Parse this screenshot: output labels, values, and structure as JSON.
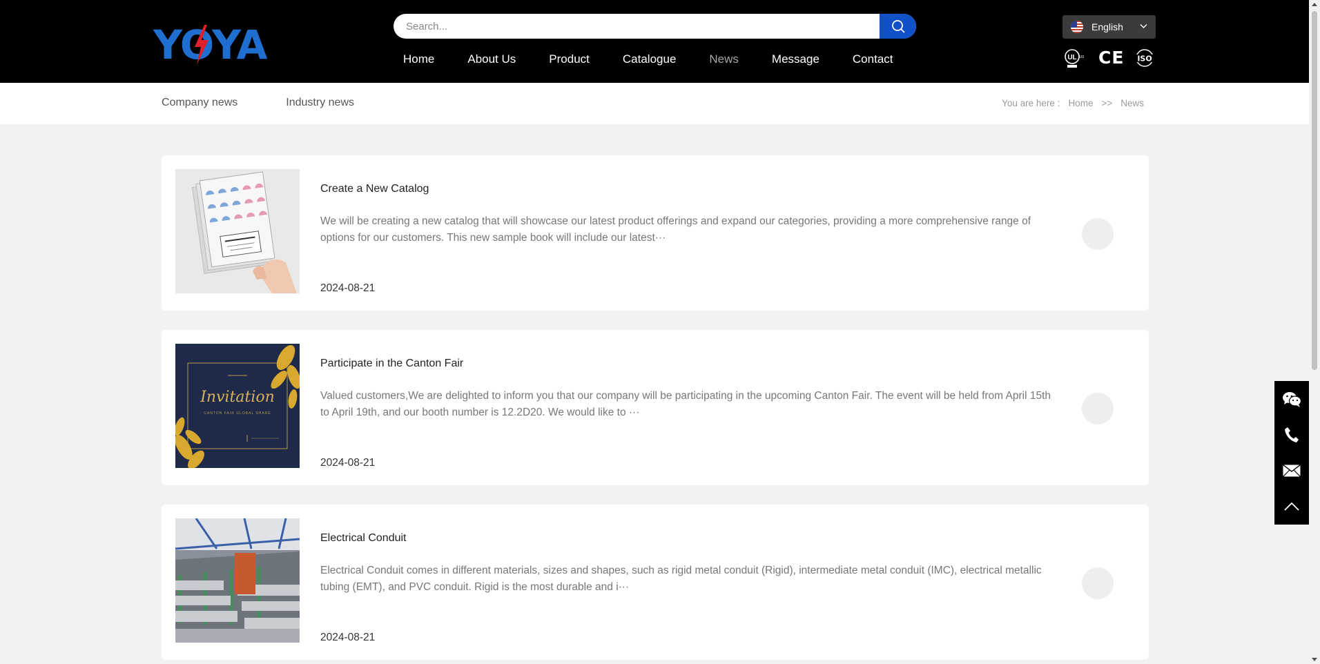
{
  "header": {
    "logo_text": "YOYA",
    "search": {
      "placeholder": "Search..."
    },
    "nav": [
      {
        "label": "Home",
        "active": false
      },
      {
        "label": "About Us",
        "active": false
      },
      {
        "label": "Product",
        "active": false
      },
      {
        "label": "Catalogue",
        "active": false
      },
      {
        "label": "News",
        "active": true
      },
      {
        "label": "Message",
        "active": false
      },
      {
        "label": "Contact",
        "active": false
      }
    ],
    "language": {
      "label": "English",
      "flag": "us-flag-icon"
    },
    "certifications": [
      "UL",
      "CE",
      "ISO"
    ]
  },
  "subnav": {
    "categories": [
      "Company news",
      "Industry news"
    ],
    "breadcrumb": {
      "prefix": "You are here :",
      "home": "Home",
      "separator": ">>",
      "current": "News"
    }
  },
  "news": [
    {
      "title": "Create a New Catalog",
      "desc": "We will be creating a new catalog that will showcase our latest product offerings and expand our categories, providing a more comprehensive range of options for our customers. This new sample book will include our latest···",
      "date": "2024-08-21"
    },
    {
      "title": "Participate in the Canton Fair",
      "desc": "Valued customers,We are delighted to inform you that our company will be participating in the upcoming Canton Fair. The event will be held from April 15th to April 19th, and our booth number is 12.2D20. We would like to ···",
      "date": "2024-08-21",
      "image_text": "Invitation",
      "image_subtext": "CANTON FAIR GLOBAL SHARE"
    },
    {
      "title": "Electrical Conduit",
      "desc": "Electrical Conduit comes in different materials, sizes and shapes, such as rigid metal conduit (Rigid), intermediate metal conduit (IMC), electrical metallic tubing (EMT), and PVC conduit. Rigid is the most durable and i···",
      "date": "2024-08-21"
    }
  ],
  "side_tools": [
    "wechat-icon",
    "phone-icon",
    "email-icon",
    "back-to-top-icon"
  ],
  "colors": {
    "header_bg": "#000000",
    "accent": "#1151c7",
    "logo_blue": "#1f6fd1",
    "bolt_red": "#e0212b",
    "page_bg": "#f2f2f2"
  }
}
